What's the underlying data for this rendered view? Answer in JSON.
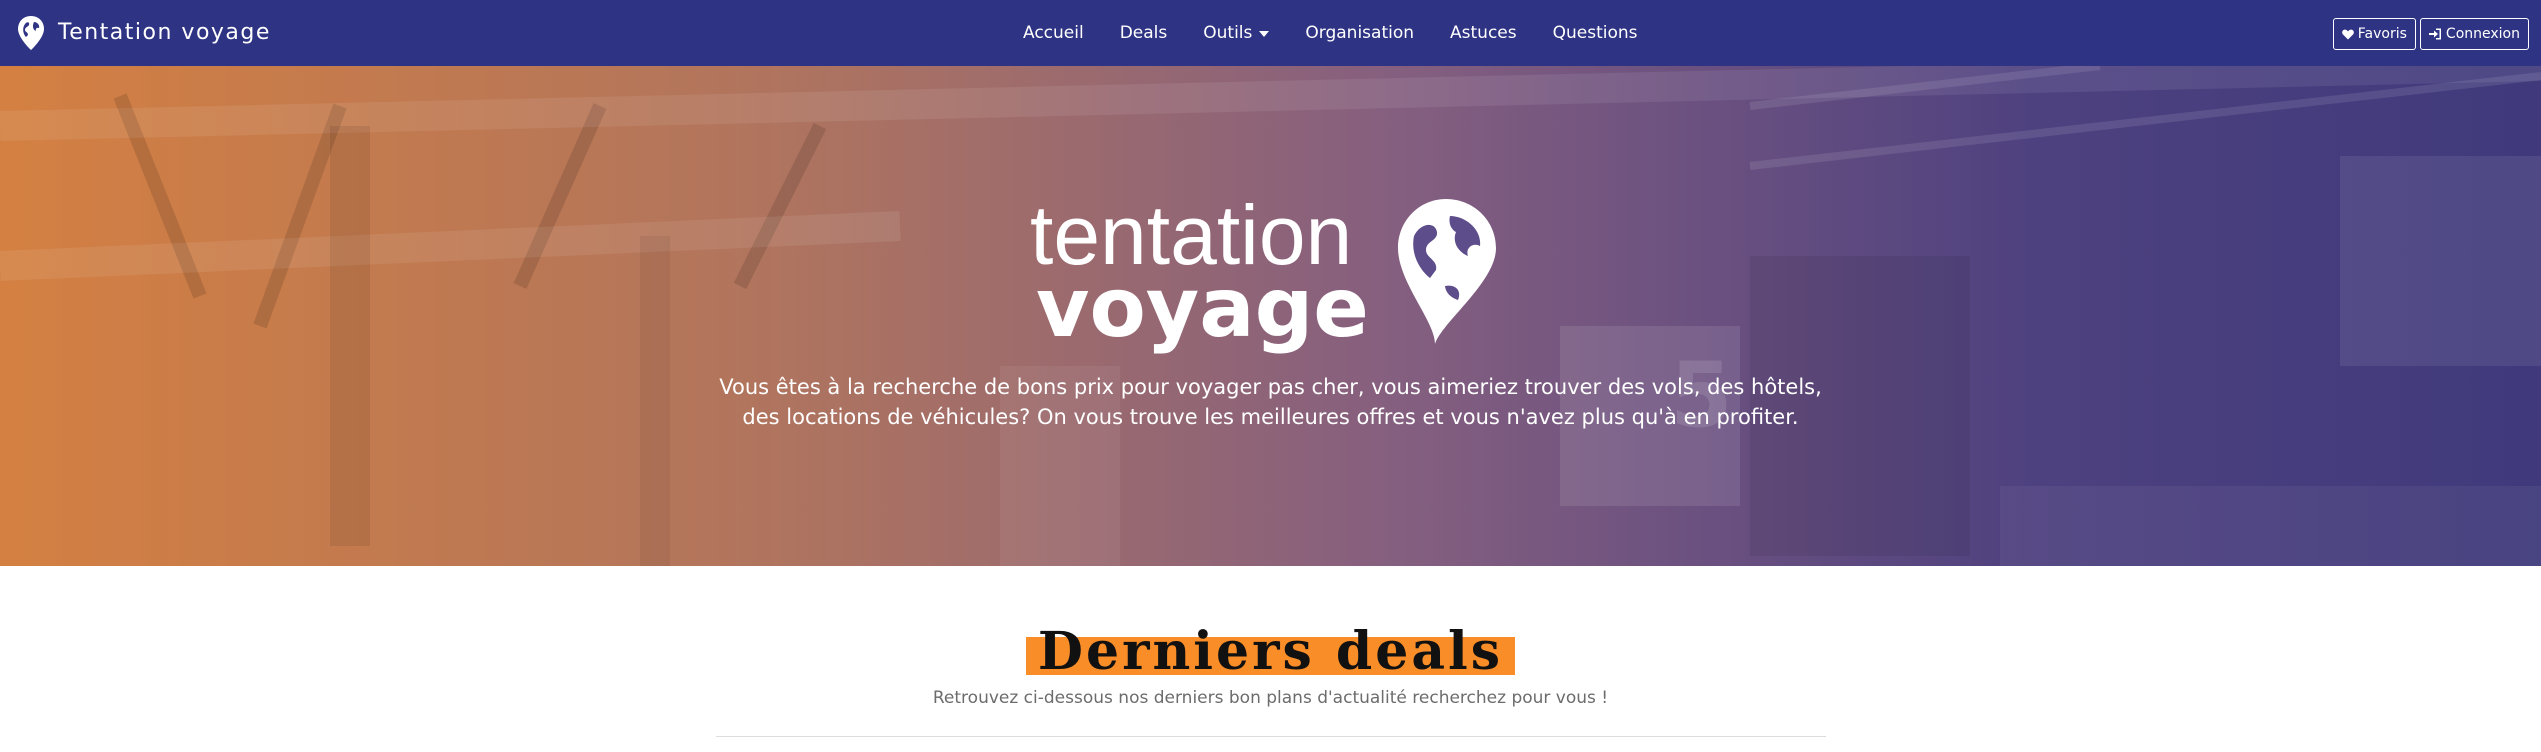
{
  "navbar": {
    "brand": "Tentation voyage",
    "brand_icon": "globe-pin-icon",
    "links": [
      {
        "label": "Accueil"
      },
      {
        "label": "Deals"
      },
      {
        "label": "Outils",
        "dropdown": true
      },
      {
        "label": "Organisation"
      },
      {
        "label": "Astuces"
      },
      {
        "label": "Questions"
      }
    ],
    "favoris_label": "Favoris",
    "favoris_icon": "heart-icon",
    "connexion_label": "Connexion",
    "connexion_icon": "sign-in-icon",
    "background_color": "#2e3383"
  },
  "hero": {
    "logo_line1": "tentation",
    "logo_line2": "voyage",
    "logo_icon": "globe-pin-icon",
    "description": "Vous êtes à la recherche de bons prix pour voyager pas cher, vous aimeriez trouver des vols, des hôtels, des locations de véhicules? On vous trouve les meilleures offres et vous n'avez plus qu'à en profiter."
  },
  "section": {
    "title": "Derniers deals",
    "subtitle": "Retrouvez ci-dessous nos derniers bon plans d'actualité recherchez pour vous !",
    "highlight_color": "#f98e29"
  }
}
